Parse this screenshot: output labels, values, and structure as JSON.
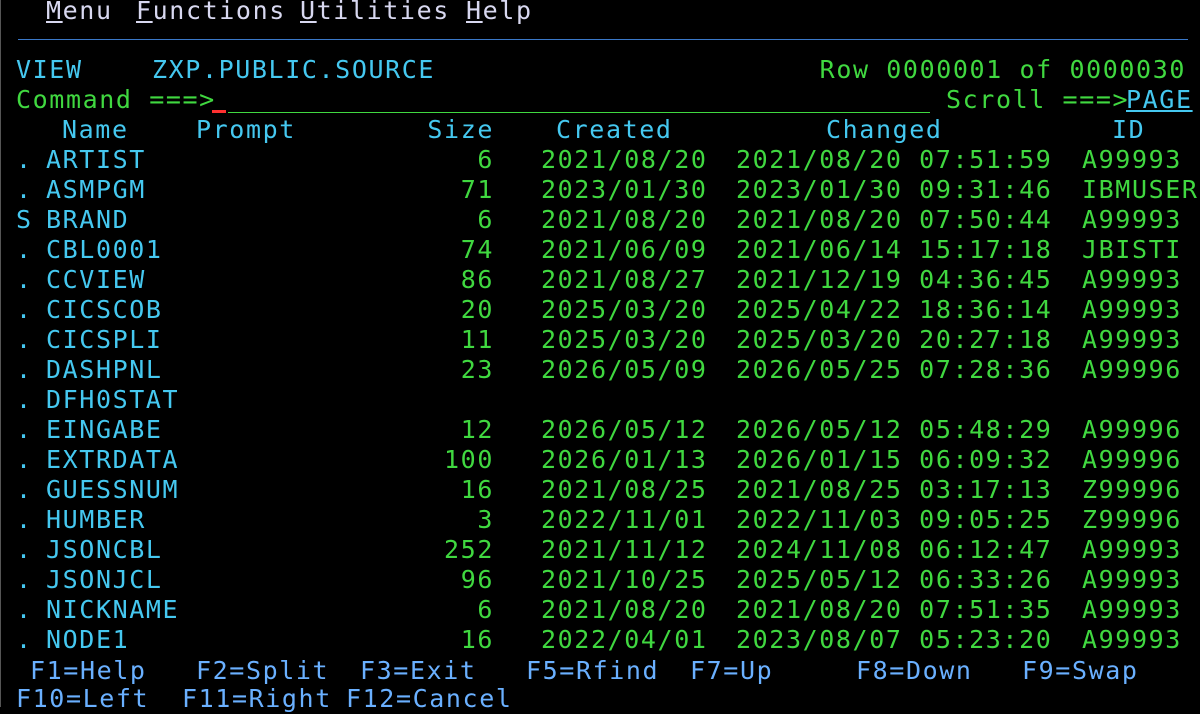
{
  "menubar": {
    "items": [
      {
        "hot": "M",
        "rest": "enu"
      },
      {
        "hot": "F",
        "rest": "unctions"
      },
      {
        "hot": "U",
        "rest": "tilities"
      },
      {
        "hot": "H",
        "rest": "elp"
      }
    ]
  },
  "header": {
    "mode": "VIEW",
    "dataset": "ZXP.PUBLIC.SOURCE",
    "row_info": "Row 0000001 of 0000030"
  },
  "command": {
    "label": "Command ===>",
    "value": "",
    "scroll_label": "Scroll ===>",
    "scroll_value": "PAGE"
  },
  "columns": {
    "name": "Name",
    "prompt": "Prompt",
    "size": "Size",
    "created": "Created",
    "changed": "Changed",
    "id": "ID"
  },
  "rows": [
    {
      "cmd": ".",
      "name": "ARTIST",
      "size": "6",
      "created": "2021/08/20",
      "changed": "2021/08/20 07:51:59",
      "id": "A99993"
    },
    {
      "cmd": ".",
      "name": "ASMPGM",
      "size": "71",
      "created": "2023/01/30",
      "changed": "2023/01/30 09:31:46",
      "id": "IBMUSER"
    },
    {
      "cmd": "S",
      "name": "BRAND",
      "size": "6",
      "created": "2021/08/20",
      "changed": "2021/08/20 07:50:44",
      "id": "A99993"
    },
    {
      "cmd": ".",
      "name": "CBL0001",
      "size": "74",
      "created": "2021/06/09",
      "changed": "2021/06/14 15:17:18",
      "id": "JBISTI"
    },
    {
      "cmd": ".",
      "name": "CCVIEW",
      "size": "86",
      "created": "2021/08/27",
      "changed": "2021/12/19 04:36:45",
      "id": "A99993"
    },
    {
      "cmd": ".",
      "name": "CICSCOB",
      "size": "20",
      "created": "2025/03/20",
      "changed": "2025/04/22 18:36:14",
      "id": "A99993"
    },
    {
      "cmd": ".",
      "name": "CICSPLI",
      "size": "11",
      "created": "2025/03/20",
      "changed": "2025/03/20 20:27:18",
      "id": "A99993"
    },
    {
      "cmd": ".",
      "name": "DASHPNL",
      "size": "23",
      "created": "2026/05/09",
      "changed": "2026/05/25 07:28:36",
      "id": "A99996"
    },
    {
      "cmd": ".",
      "name": "DFH0STAT",
      "size": "",
      "created": "",
      "changed": "",
      "id": ""
    },
    {
      "cmd": ".",
      "name": "EINGABE",
      "size": "12",
      "created": "2026/05/12",
      "changed": "2026/05/12 05:48:29",
      "id": "A99996"
    },
    {
      "cmd": ".",
      "name": "EXTRDATA",
      "size": "100",
      "created": "2026/01/13",
      "changed": "2026/01/15 06:09:32",
      "id": "A99996"
    },
    {
      "cmd": ".",
      "name": "GUESSNUM",
      "size": "16",
      "created": "2021/08/25",
      "changed": "2021/08/25 03:17:13",
      "id": "Z99996"
    },
    {
      "cmd": ".",
      "name": "HUMBER",
      "size": "3",
      "created": "2022/11/01",
      "changed": "2022/11/03 09:05:25",
      "id": "Z99996"
    },
    {
      "cmd": ".",
      "name": "JSONCBL",
      "size": "252",
      "created": "2021/11/12",
      "changed": "2024/11/08 06:12:47",
      "id": "A99993"
    },
    {
      "cmd": ".",
      "name": "JSONJCL",
      "size": "96",
      "created": "2021/10/25",
      "changed": "2025/05/12 06:33:26",
      "id": "A99993"
    },
    {
      "cmd": ".",
      "name": "NICKNAME",
      "size": "6",
      "created": "2021/08/20",
      "changed": "2021/08/20 07:51:35",
      "id": "A99993"
    },
    {
      "cmd": ".",
      "name": "NODE1",
      "size": "16",
      "created": "2022/04/01",
      "changed": "2023/08/07 05:23:20",
      "id": "A99993"
    }
  ],
  "fkeys_row1": [
    "F1=Help",
    "F2=Split",
    "F3=Exit",
    "F5=Rfind",
    "F7=Up",
    "F8=Down",
    "F9=Swap"
  ],
  "fkeys_row2": [
    "F10=Left",
    "F11=Right",
    "F12=Cancel"
  ],
  "colors": {
    "background": "#000000",
    "field_green": "#40d840",
    "label_turquoise": "#45c8f0",
    "menu_white": "#d8d8f0",
    "separator_blue": "#3a78c8",
    "cursor_red": "#ff3030"
  }
}
